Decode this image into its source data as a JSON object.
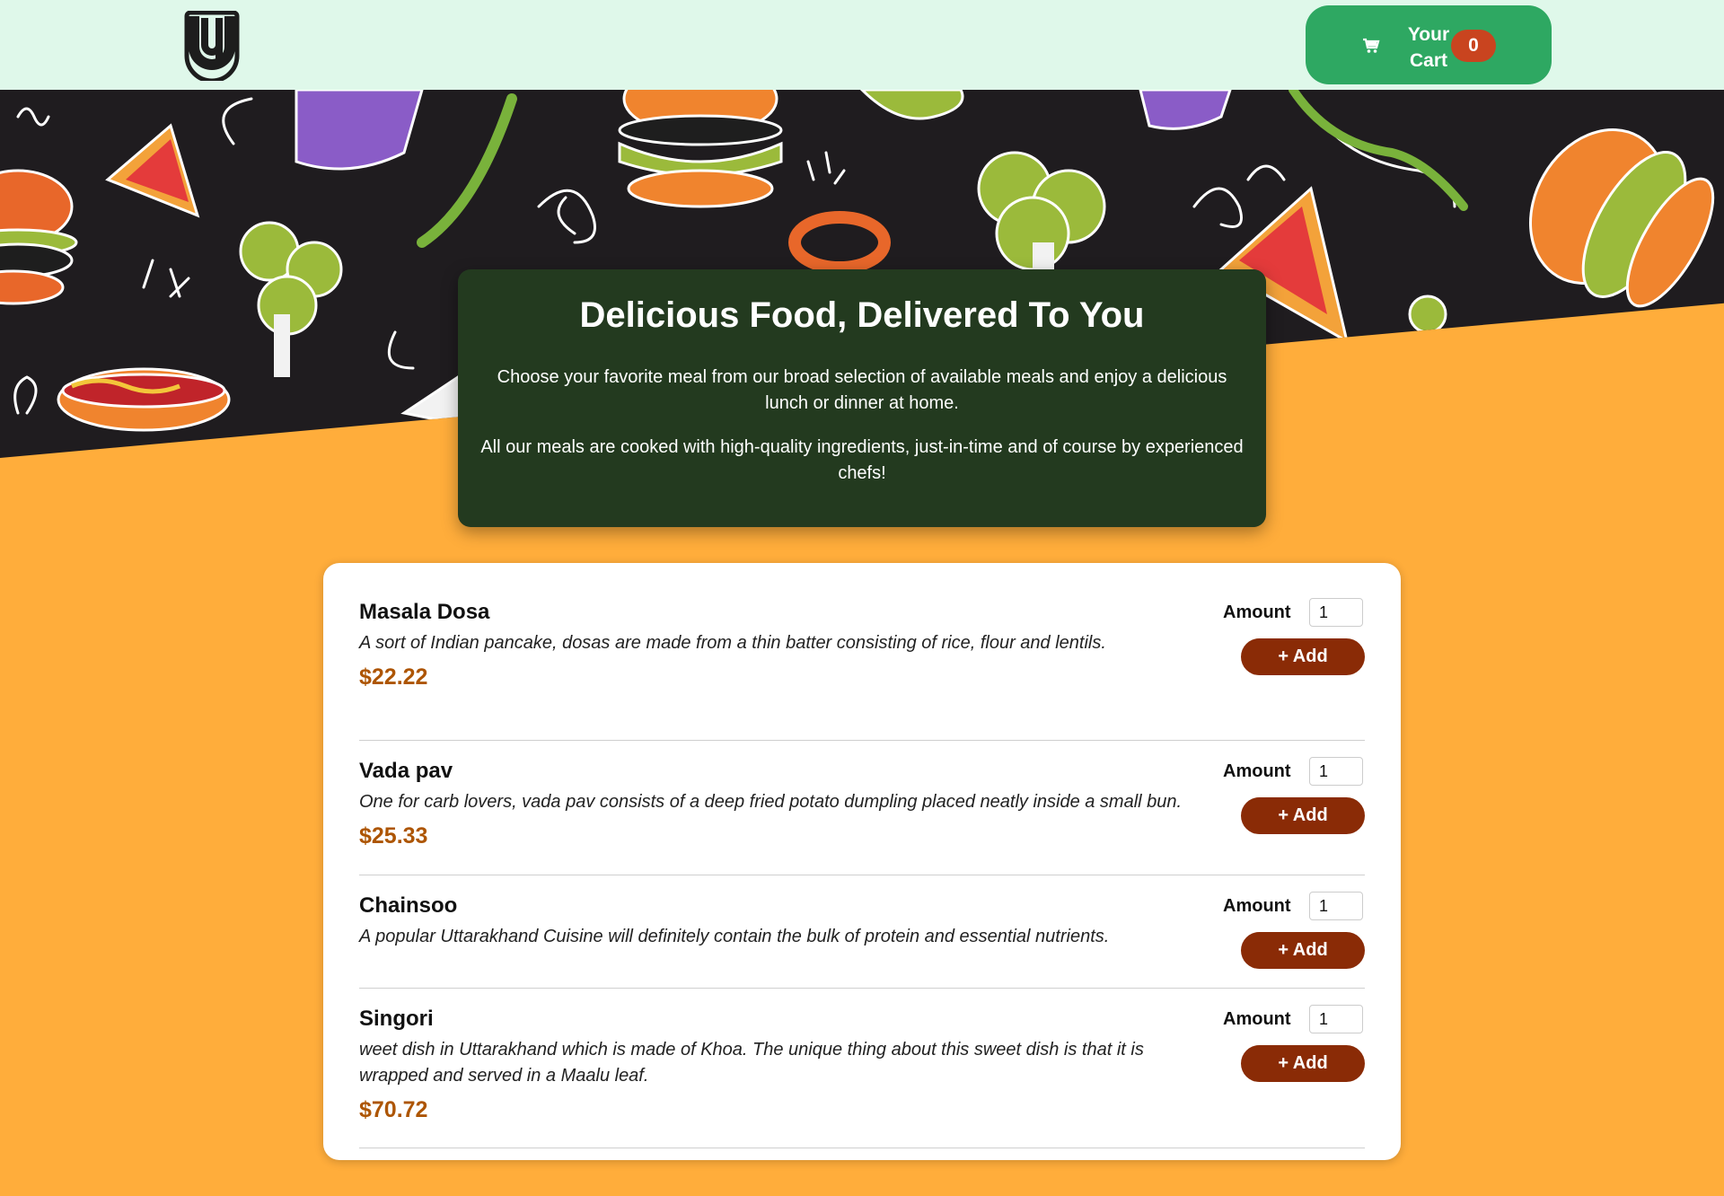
{
  "header": {
    "logo_icon": "u-logo-icon",
    "cart": {
      "icon": "cart-icon",
      "label": "Your Cart",
      "count": "0"
    }
  },
  "summary": {
    "title": "Delicious Food, Delivered To You",
    "paragraph1": "Choose your favorite meal from our broad selection of available meals and enjoy a delicious lunch or dinner at home.",
    "paragraph2": "All our meals are cooked with high-quality ingredients, just-in-time and of course by experienced chefs!"
  },
  "meals": [
    {
      "name": "Masala Dosa",
      "description": "A sort of Indian pancake, dosas are made from a thin batter consisting of rice, flour and lentils.",
      "price": "$22.22",
      "amount_label": "Amount",
      "amount": "1",
      "add_label": "+ Add"
    },
    {
      "name": "Vada pav",
      "description": "One for carb lovers, vada pav consists of a deep fried potato dumpling placed neatly inside a small bun.",
      "price": "$25.33",
      "amount_label": "Amount",
      "amount": "1",
      "add_label": "+ Add"
    },
    {
      "name": "Chainsoo",
      "description": "A popular Uttarakhand Cuisine will definitely contain the bulk of protein and essential nutrients.",
      "price": "",
      "amount_label": "Amount",
      "amount": "1",
      "add_label": "+ Add"
    },
    {
      "name": "Singori",
      "description": "weet dish in Uttarakhand which is made of Khoa. The unique thing about this sweet dish is that it is wrapped and served in a Maalu leaf.",
      "price": "$70.72",
      "amount_label": "Amount",
      "amount": "1",
      "add_label": "+ Add"
    }
  ],
  "colors": {
    "header_bg": "#dff8ea",
    "cart_button": "#2ea862",
    "cart_badge": "#c9441f",
    "page_bg": "#ffad3b",
    "hero_bg": "#1f1c1f",
    "summary_bg": "#233a1f",
    "price": "#ad5502",
    "add_button": "#8a2b06"
  }
}
